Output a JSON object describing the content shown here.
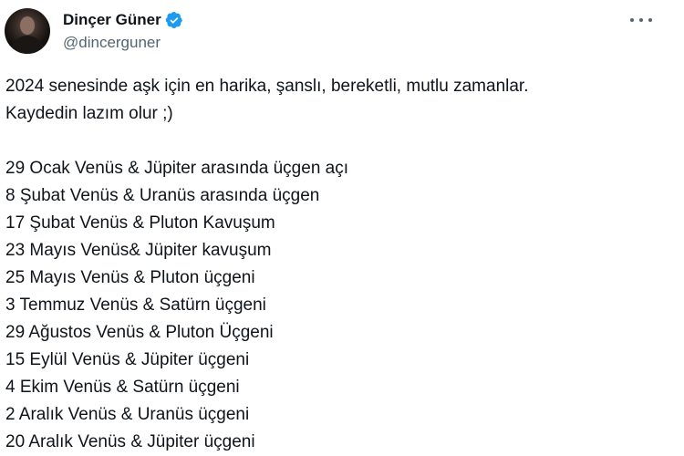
{
  "author": {
    "display_name": "Dinçer Güner",
    "handle": "@dincerguner",
    "verified": true,
    "avatar_icon": "profile-photo",
    "verified_icon": "verified-badge-icon",
    "accent_color": "#1d9bf0"
  },
  "menu": {
    "icon": "more-options-icon"
  },
  "tweet": {
    "intro_lines": [
      "2024 senesinde aşk için en harika, şanslı, bereketli, mutlu zamanlar.",
      "Kaydedin lazım olur ;)"
    ],
    "dates": [
      "29 Ocak Venüs & Jüpiter arasında üçgen açı",
      "8 Şubat Venüs & Uranüs arasında üçgen",
      "17 Şubat Venüs & Pluton Kavuşum",
      "23 Mayıs Venüs& Jüpiter kavuşum",
      "25 Mayıs Venüs & Pluton üçgeni",
      "3 Temmuz Venüs & Satürn üçgeni",
      "29 Ağustos Venüs & Pluton Üçgeni",
      "15 Eylül Venüs & Jüpiter üçgeni",
      "4 Ekim Venüs & Satürn üçgeni",
      "2 Aralık Venüs & Uranüs üçgeni",
      "20 Aralık Venüs & Jüpiter üçgeni"
    ]
  }
}
